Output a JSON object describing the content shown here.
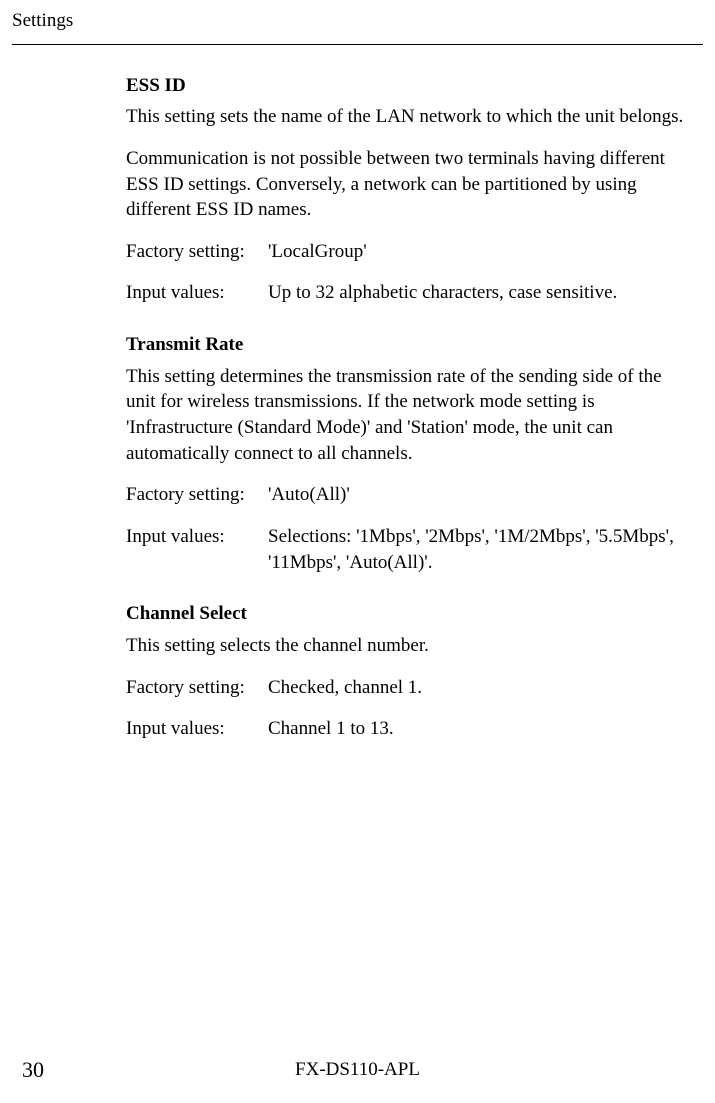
{
  "header": {
    "title": "Settings"
  },
  "sections": {
    "ess": {
      "heading": "ESS ID",
      "p1": "This setting sets the name of the LAN network to which the unit belongs.",
      "p2": "Communication is not possible between two terminals having different ESS ID settings.    Conversely, a network can be partitioned by using different ESS ID names.",
      "factory_label": "Factory setting:",
      "factory_value": "'LocalGroup'",
      "input_label": "Input values:",
      "input_value": "Up to 32 alphabetic characters, case sensitive."
    },
    "transmit": {
      "heading": "Transmit Rate",
      "p1": "This setting determines the transmission rate of the sending side of the unit for wireless transmissions.    If the network mode setting is 'Infrastructure (Standard Mode)' and 'Station' mode, the unit can automatically connect to all channels.",
      "factory_label": "Factory setting:",
      "factory_value": "'Auto(All)'",
      "input_label": "Input values:",
      "input_value": "Selections: '1Mbps', '2Mbps', '1M/2Mbps', '5.5Mbps', '11Mbps', 'Auto(All)'."
    },
    "channel": {
      "heading": "Channel Select",
      "p1": "This setting selects the channel number.",
      "factory_label": "Factory setting:",
      "factory_value": "Checked, channel 1.",
      "input_label": "Input values:",
      "input_value": "Channel 1 to 13."
    }
  },
  "footer": {
    "page_number": "30",
    "doc_id": "FX-DS110-APL"
  }
}
